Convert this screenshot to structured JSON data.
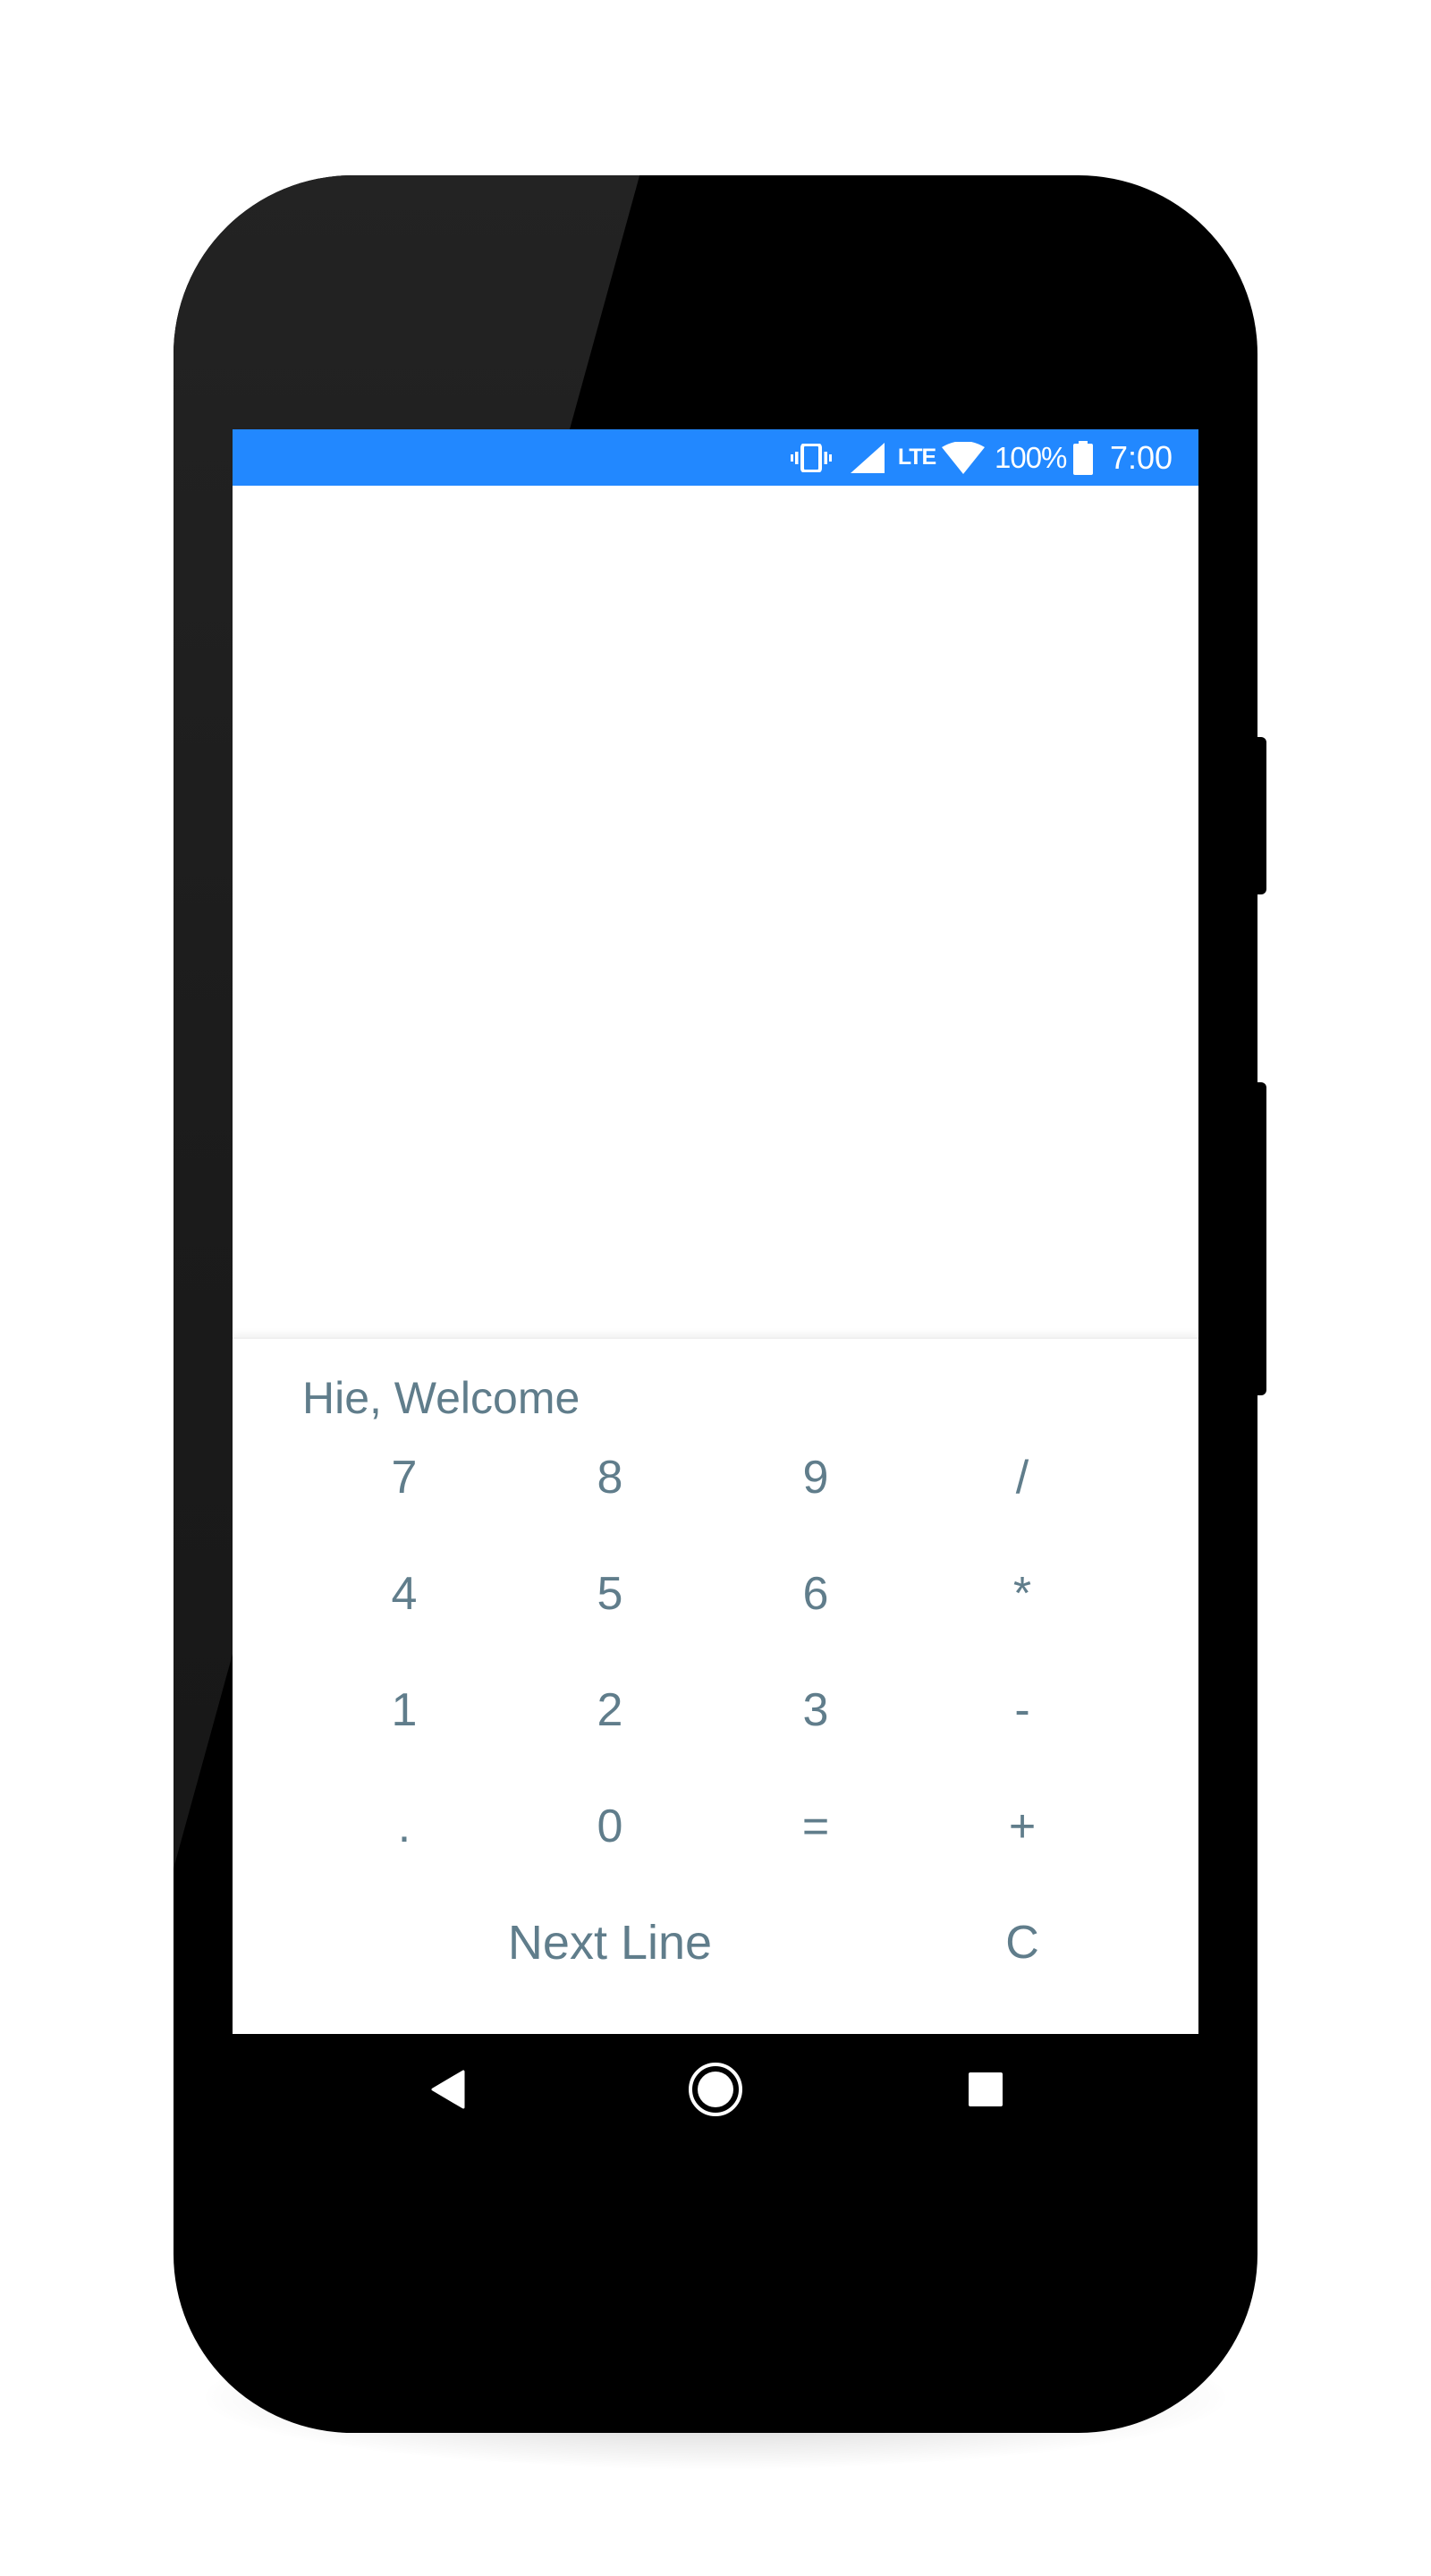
{
  "theme": {
    "accent": "#2288ff",
    "text_color": "#607d8b",
    "device_color": "#000000"
  },
  "status_bar": {
    "icons": [
      "vibrate-icon",
      "cellular-signal-icon",
      "lte-icon",
      "wifi-icon",
      "battery-icon"
    ],
    "network_label": "LTE",
    "battery_percent": "100%",
    "time": "7:00"
  },
  "keypad": {
    "greeting": "Hie, Welcome",
    "rows": [
      [
        "7",
        "8",
        "9",
        "/"
      ],
      [
        "4",
        "5",
        "6",
        "*"
      ],
      [
        "1",
        "2",
        "3",
        "-"
      ],
      [
        ".",
        "0",
        "=",
        "+"
      ]
    ],
    "next_line_label": "Next Line",
    "clear_label": "C"
  },
  "navigation_bar": {
    "icons": [
      "back-icon",
      "home-icon",
      "recents-icon"
    ]
  }
}
